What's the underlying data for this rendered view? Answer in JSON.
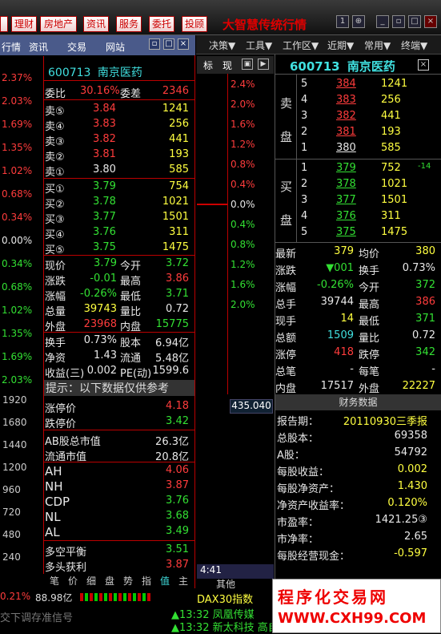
{
  "topbar": {
    "buttons": [
      "理财",
      "房地产",
      "资讯",
      "服务",
      "委托",
      "投顾"
    ],
    "title": "大智慧传统行情",
    "menu": [
      "决策▼",
      "工具▼",
      "工作区▼",
      "近期▼",
      "常用▼",
      "终端▼"
    ]
  },
  "left_tabs": [
    "行情",
    "资讯",
    "交易",
    "网站"
  ],
  "left_axis_pct": [
    "2.37%",
    "2.03%",
    "1.69%",
    "1.35%",
    "1.02%",
    "0.68%",
    "0.34%",
    "0.00%",
    "0.34%",
    "0.68%",
    "1.02%",
    "1.35%",
    "1.69%",
    "2.03%"
  ],
  "left_axis_vol": [
    "1920",
    "1680",
    "1440",
    "1200",
    "960",
    "720",
    "480",
    "240"
  ],
  "quote": {
    "code": "600713",
    "name": "南京医药",
    "weibi_label": "委比",
    "weibi": "30.16%",
    "weicha_label": "委差",
    "weicha": "2346",
    "sell": [
      {
        "l": "卖⑤",
        "p": "3.84",
        "v": "1241"
      },
      {
        "l": "卖④",
        "p": "3.83",
        "v": "256"
      },
      {
        "l": "卖③",
        "p": "3.82",
        "v": "441"
      },
      {
        "l": "卖②",
        "p": "3.81",
        "v": "193"
      },
      {
        "l": "卖①",
        "p": "3.80",
        "v": "585"
      }
    ],
    "buy": [
      {
        "l": "买①",
        "p": "3.79",
        "v": "754"
      },
      {
        "l": "买②",
        "p": "3.78",
        "v": "1021"
      },
      {
        "l": "买③",
        "p": "3.77",
        "v": "1501"
      },
      {
        "l": "买④",
        "p": "3.76",
        "v": "311"
      },
      {
        "l": "买⑤",
        "p": "3.75",
        "v": "1475"
      }
    ],
    "stats": [
      {
        "a": "现价",
        "av": "3.79",
        "b": "今开",
        "bv": "3.72"
      },
      {
        "a": "涨跌",
        "av": "-0.01",
        "b": "最高",
        "bv": "3.86"
      },
      {
        "a": "涨幅",
        "av": "-0.26%",
        "b": "最低",
        "bv": "3.71"
      },
      {
        "a": "总量",
        "av": "39743",
        "b": "量比",
        "bv": "0.72"
      },
      {
        "a": "外盘",
        "av": "23968",
        "b": "内盘",
        "bv": "15775"
      }
    ],
    "stats2": [
      {
        "a": "换手",
        "av": "0.73%",
        "b": "股本",
        "bv": "6.94亿"
      },
      {
        "a": "净资",
        "av": "1.43",
        "b": "流通",
        "bv": "5.48亿"
      },
      {
        "a": "收益(三)",
        "av": "0.002",
        "b": "PE(动)",
        "bv": "1599.6"
      }
    ],
    "notice": "提示：以下数据仅供参考",
    "limits": [
      {
        "a": "涨停价",
        "v": "4.18"
      },
      {
        "a": "跌停价",
        "v": "3.42"
      }
    ],
    "mkt": [
      {
        "a": "AB股总市值",
        "v": "26.3亿"
      },
      {
        "a": "流通市值",
        "v": "20.8亿"
      }
    ],
    "ind": [
      {
        "a": "AH",
        "v": "4.06"
      },
      {
        "a": "NH",
        "v": "3.87"
      },
      {
        "a": "CDP",
        "v": "3.76"
      },
      {
        "a": "NL",
        "v": "3.68"
      },
      {
        "a": "AL",
        "v": "3.49"
      }
    ],
    "ind2": [
      {
        "a": "多空平衡",
        "v": "3.51"
      },
      {
        "a": "多头获利",
        "v": "3.87"
      }
    ]
  },
  "bottom_tabs": [
    "笔",
    "价",
    "细",
    "盘",
    "势",
    "指",
    "值",
    "主"
  ],
  "mid": {
    "tabs": [
      "标",
      "现"
    ],
    "pcts_up": [
      "2.4%",
      "2.0%",
      "1.6%",
      "1.2%",
      "0.8%",
      "0.4%",
      "0.0%",
      "0.4%",
      "0.8%",
      "1.2%",
      "1.6%",
      "2.0%"
    ],
    "vol": "435.040",
    "time": "4:41",
    "other": "其他"
  },
  "right": {
    "code": "600713",
    "name": "南京医药",
    "sell_label": [
      "卖",
      "盘"
    ],
    "buy_label": [
      "买",
      "盘"
    ],
    "sell": [
      {
        "n": "5",
        "p": "384",
        "v": "1241"
      },
      {
        "n": "4",
        "p": "383",
        "v": "256"
      },
      {
        "n": "3",
        "p": "382",
        "v": "441"
      },
      {
        "n": "2",
        "p": "381",
        "v": "193"
      },
      {
        "n": "1",
        "p": "380",
        "v": "585"
      }
    ],
    "buy": [
      {
        "n": "1",
        "p": "379",
        "v": "752",
        "c": "-14"
      },
      {
        "n": "2",
        "p": "378",
        "v": "1021"
      },
      {
        "n": "3",
        "p": "377",
        "v": "1501"
      },
      {
        "n": "4",
        "p": "376",
        "v": "311"
      },
      {
        "n": "5",
        "p": "375",
        "v": "1475"
      }
    ],
    "stats": [
      {
        "a": "最新",
        "av": "379",
        "b": "均价",
        "bv": "380"
      },
      {
        "a": "涨跌",
        "av": "▼001",
        "b": "换手",
        "bv": "0.73%"
      },
      {
        "a": "涨幅",
        "av": "-0.26%",
        "b": "今开",
        "bv": "372"
      },
      {
        "a": "总手",
        "av": "39744",
        "b": "最高",
        "bv": "386"
      },
      {
        "a": "现手",
        "av": "14",
        "b": "最低",
        "bv": "371"
      },
      {
        "a": "总额",
        "av": "1509",
        "b": "量比",
        "bv": "0.72"
      },
      {
        "a": "涨停",
        "av": "418",
        "b": "跌停",
        "bv": "342"
      },
      {
        "a": "总笔",
        "av": "-",
        "b": "每笔",
        "bv": "-"
      },
      {
        "a": "内盘",
        "av": "17517",
        "b": "外盘",
        "bv": "22227"
      }
    ],
    "fin_title": "财务数据",
    "fin": [
      {
        "a": "报告期：",
        "v": "20110930三季报"
      },
      {
        "a": "总股本：",
        "v": "69358"
      },
      {
        "a": "A股：",
        "v": "54792"
      },
      {
        "a": "每股收益：",
        "v": "0.002"
      },
      {
        "a": "每股净资产：",
        "v": "1.430"
      },
      {
        "a": "净资产收益率：",
        "v": "0.120%"
      },
      {
        "a": "市盈率：",
        "v": "1421.25③"
      },
      {
        "a": "市净率：",
        "v": "2.65"
      },
      {
        "a": "每股经营现金：",
        "v": "-0.597"
      }
    ]
  },
  "status": {
    "pct": "0.21%",
    "amt": "88.98亿",
    "dax": "DAX30指数",
    "msg": "交下调存准信号",
    "ticker1": "▲13:32 凤凰传媒",
    "ticker2": "▲13:32 新太科技 高自旋示"
  },
  "watermark": {
    "line1": "程序化交易网",
    "line2": "WWW.CXH99.COM"
  }
}
